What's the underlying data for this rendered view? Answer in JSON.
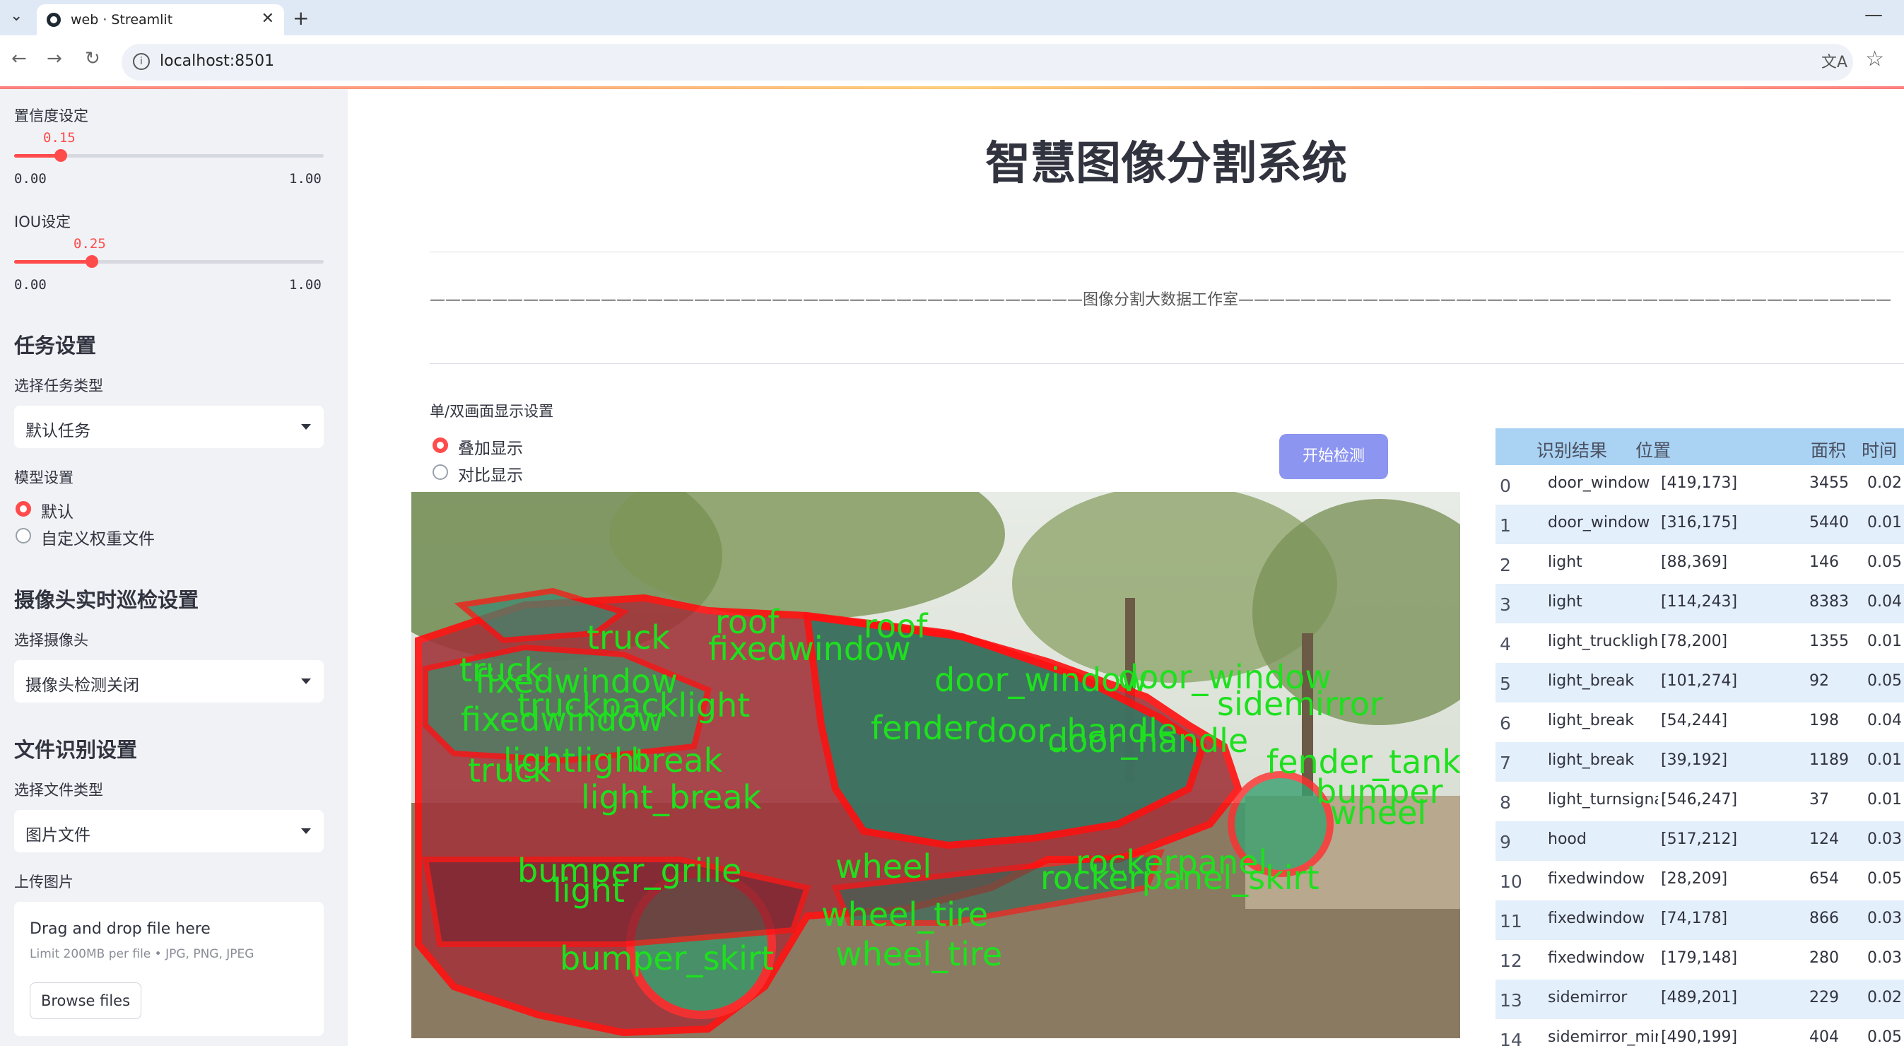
{
  "browser": {
    "tab_title": "web · Streamlit",
    "url": "localhost:8501"
  },
  "sidebar": {
    "confidence": {
      "label": "置信度设定",
      "value": "0.15",
      "value_num": 0.15,
      "min": "0.00",
      "max": "1.00"
    },
    "iou": {
      "label": "IOU设定",
      "value": "0.25",
      "value_num": 0.25,
      "min": "0.00",
      "max": "1.00"
    },
    "task_section": {
      "heading": "任务设置",
      "label": "选择任务类型",
      "selected": "默认任务"
    },
    "model_section": {
      "label": "模型设置",
      "options": [
        "默认",
        "自定义权重文件"
      ],
      "selected_index": 0
    },
    "camera_section": {
      "heading": "摄像头实时巡检设置",
      "label": "选择摄像头",
      "selected": "摄像头检测关闭"
    },
    "file_section": {
      "heading": "文件识别设置",
      "label": "选择文件类型",
      "selected": "图片文件"
    },
    "upload": {
      "label": "上传图片",
      "drop_text": "Drag and drop file here",
      "limit_text": "Limit 200MB per file • JPG, PNG, JPEG",
      "browse_label": "Browse files"
    }
  },
  "main": {
    "title": "智慧图像分割系统",
    "studio_line": "——————————————————————————————————————————图像分割大数据工作室——————————————————————————————————————————",
    "display_mode": {
      "label": "单/双画面显示设置",
      "options": [
        "叠加显示",
        "对比显示"
      ],
      "selected_index": 0
    },
    "detect_button": "开始检测"
  },
  "image_labels": [
    "roof",
    "truck",
    "roof",
    "fixedwindow",
    "truck",
    "fixedwindow",
    "door_window",
    "door_window",
    "truckpacklight",
    "fixedwindow",
    "sidemirror",
    "fender",
    "door_handle",
    "door_handle",
    "lightlight",
    "break",
    "fender_tank",
    "truck",
    "light_break",
    "bumper",
    "wheel",
    "bumper_grille",
    "light",
    "wheel",
    "rockerpanel",
    "rockerpanel_skirt",
    "wheel_tire",
    "bumper_skirt",
    "wheel_tire"
  ],
  "results_table": {
    "columns": [
      "识别结果",
      "位置",
      "面积",
      "时间"
    ],
    "rows": [
      {
        "idx": "0",
        "name": "door_window",
        "pos": "[419,173]",
        "area": "3455",
        "time": "0.02"
      },
      {
        "idx": "1",
        "name": "door_window",
        "pos": "[316,175]",
        "area": "5440",
        "time": "0.01"
      },
      {
        "idx": "2",
        "name": "light",
        "pos": "[88,369]",
        "area": "146",
        "time": "0.05"
      },
      {
        "idx": "3",
        "name": "light",
        "pos": "[114,243]",
        "area": "8383",
        "time": "0.04"
      },
      {
        "idx": "4",
        "name": "light_trucklight",
        "pos": "[78,200]",
        "area": "1355",
        "time": "0.01"
      },
      {
        "idx": "5",
        "name": "light_break",
        "pos": "[101,274]",
        "area": "92",
        "time": "0.05"
      },
      {
        "idx": "6",
        "name": "light_break",
        "pos": "[54,244]",
        "area": "198",
        "time": "0.04"
      },
      {
        "idx": "7",
        "name": "light_break",
        "pos": "[39,192]",
        "area": "1189",
        "time": "0.01"
      },
      {
        "idx": "8",
        "name": "light_turnsignal",
        "pos": "[546,247]",
        "area": "37",
        "time": "0.01"
      },
      {
        "idx": "9",
        "name": "hood",
        "pos": "[517,212]",
        "area": "124",
        "time": "0.03"
      },
      {
        "idx": "10",
        "name": "fixedwindow",
        "pos": "[28,209]",
        "area": "654",
        "time": "0.05"
      },
      {
        "idx": "11",
        "name": "fixedwindow",
        "pos": "[74,178]",
        "area": "866",
        "time": "0.03"
      },
      {
        "idx": "12",
        "name": "fixedwindow",
        "pos": "[179,148]",
        "area": "280",
        "time": "0.03"
      },
      {
        "idx": "13",
        "name": "sidemirror",
        "pos": "[489,201]",
        "area": "229",
        "time": "0.02"
      },
      {
        "idx": "14",
        "name": "sidemirror_mirror",
        "pos": "[490,199]",
        "area": "404",
        "time": "0.05"
      }
    ]
  },
  "colors": {
    "accent": "#ff4b4b",
    "button": "#8c95f0",
    "table_header": "#a9d2f3",
    "row_alt": "#e3effa",
    "mask_outline": "#ff1010",
    "label_green": "#1ee01e"
  }
}
